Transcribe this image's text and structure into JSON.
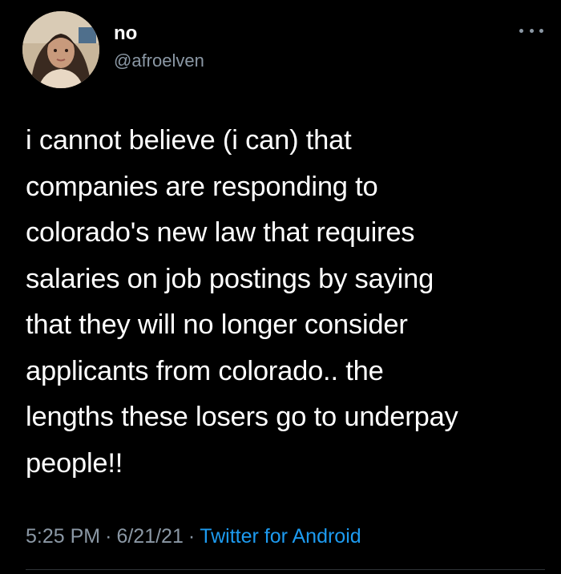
{
  "colors": {
    "background": "#000000",
    "text_primary": "#ffffff",
    "text_secondary": "#8b98a5",
    "link": "#1d9bf0",
    "divider": "#2f3336"
  },
  "author": {
    "display_name": "no",
    "handle": "@afroelven",
    "avatar_icon": "profile-photo"
  },
  "more_menu_icon": "more-horizontal-icon",
  "tweet": {
    "text": "i cannot believe (i can) that\ncompanies are responding to\ncolorado's new law that requires\nsalaries on job postings by saying\nthat they will no longer consider\napplicants from colorado.. the\nlengths these losers go to underpay\npeople!!"
  },
  "meta": {
    "time": "5:25 PM",
    "separator": "·",
    "date": "6/21/21",
    "source": "Twitter for Android"
  }
}
